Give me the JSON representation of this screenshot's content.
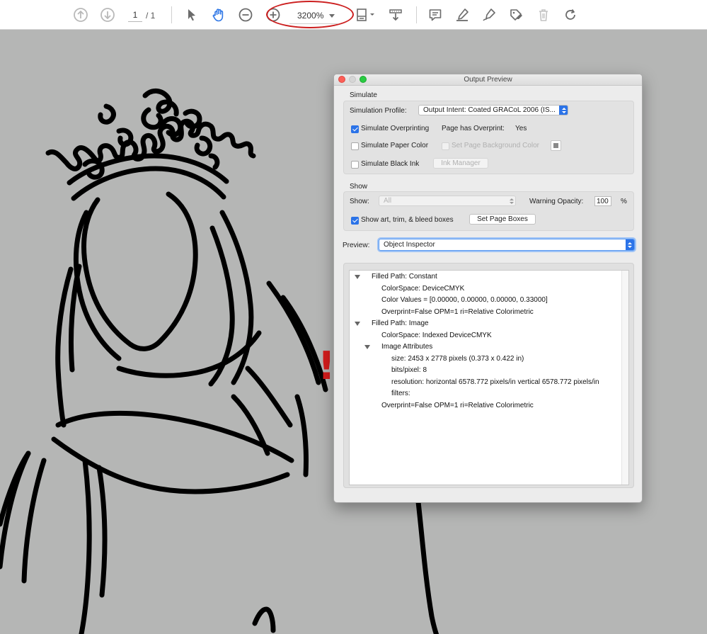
{
  "toolbar": {
    "page_current": "1",
    "page_total": "/ 1",
    "zoom_value": "3200%"
  },
  "dialog": {
    "title": "Output Preview",
    "simulate": {
      "group_label": "Simulate",
      "profile_label": "Simulation Profile:",
      "profile_value": "Output Intent: Coated GRACoL 2006 (IS...",
      "overprinting_label": "Simulate Overprinting",
      "overprinting_checked": true,
      "page_has_overprint_label": "Page has Overprint:",
      "page_has_overprint_value": "Yes",
      "paper_color_label": "Simulate Paper Color",
      "bg_color_label": "Set Page Background Color",
      "black_ink_label": "Simulate Black Ink",
      "ink_manager_label": "Ink Manager"
    },
    "show": {
      "group_label": "Show",
      "show_label": "Show:",
      "show_value": "All",
      "warning_opacity_label": "Warning Opacity:",
      "warning_opacity_value": "100",
      "percent": "%",
      "boxes_label": "Show art, trim, & bleed boxes",
      "set_page_boxes_label": "Set Page Boxes"
    },
    "preview": {
      "label": "Preview:",
      "value": "Object Inspector"
    },
    "inspector": {
      "rows": [
        "Filled Path: Constant",
        "ColorSpace: DeviceCMYK",
        "Color Values = [0.00000, 0.00000, 0.00000, 0.33000]",
        "Overprint=False OPM=1 ri=Relative Colorimetric",
        "Filled Path: Image",
        "ColorSpace: Indexed DeviceCMYK",
        "Image Attributes",
        "size: 2453 x 2778 pixels (0.373 x 0.422 in)",
        "bits/pixel: 8",
        "resolution: horizontal 6578.772 pixels/in vertical 6578.772 pixels/in",
        "filters:",
        "Overprint=False OPM=1 ri=Relative Colorimetric"
      ]
    }
  },
  "annotation": {
    "exclamation": "!",
    "color": "#d41c1c"
  },
  "colors": {
    "accent_blue": "#2b73e8",
    "canvas_gray": "#b5b6b5"
  }
}
